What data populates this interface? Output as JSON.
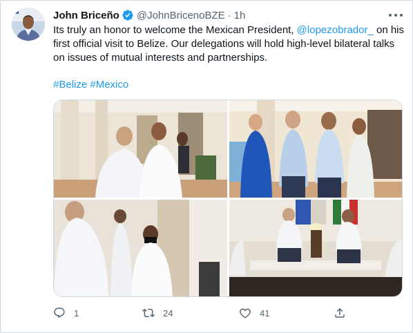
{
  "tweet": {
    "author_name": "John Briceño",
    "handle": "@JohnBricenoBZE",
    "separator": "·",
    "time": "1h",
    "verified": true,
    "text_before": "Its truly an honor to welcome the Mexican President, ",
    "mention": "@lopezobrador_",
    "text_after": " on his first official visit to Belize. Our delegations will hold high-level bilateral talks on issues of mutual interests and partnerships.",
    "hashtags": [
      "#Belize",
      "#Mexico"
    ]
  },
  "media": {
    "photo_count": 4
  },
  "actions": {
    "reply_count": "1",
    "retweet_count": "24",
    "like_count": "41"
  },
  "colors": {
    "accent": "#1d9bf0",
    "text": "#0f1419",
    "muted": "#536471",
    "border": "#cfd9de"
  },
  "icons": [
    "verified-badge-icon",
    "more-icon",
    "reply-icon",
    "retweet-icon",
    "like-icon",
    "share-icon"
  ]
}
